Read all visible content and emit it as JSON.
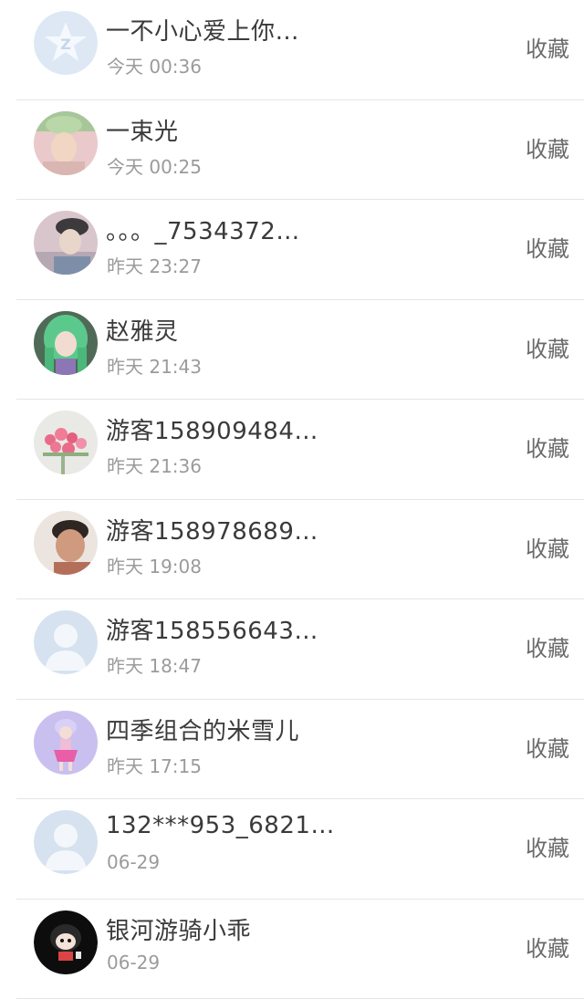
{
  "contacts": [
    {
      "name": "一不小心爱上你…",
      "time": "今天 00:36",
      "action": "收藏",
      "avatar": "qzone-star-avatar"
    },
    {
      "name": "一束光",
      "time": "今天 00:25",
      "action": "收藏",
      "avatar": "photo-avatar"
    },
    {
      "name": "。。。_7534372…",
      "time": "昨天 23:27",
      "action": "收藏",
      "avatar": "photo-avatar"
    },
    {
      "name": "赵雅灵",
      "time": "昨天 21:43",
      "action": "收藏",
      "avatar": "anime-avatar"
    },
    {
      "name": "游客158909484…",
      "time": "昨天 21:36",
      "action": "收藏",
      "avatar": "flowers-avatar"
    },
    {
      "name": "游客158978689…",
      "time": "昨天 19:08",
      "action": "收藏",
      "avatar": "photo-avatar"
    },
    {
      "name": "游客158556643…",
      "time": "昨天 18:47",
      "action": "收藏",
      "avatar": "default-person-avatar"
    },
    {
      "name": "四季组合的米雪儿",
      "time": "昨天 17:15",
      "action": "收藏",
      "avatar": "anime-avatar"
    },
    {
      "name": "132***953_6821…",
      "time": "06-29",
      "action": "收藏",
      "avatar": "default-person-avatar"
    },
    {
      "name": "银河游骑小乖",
      "time": "06-29",
      "action": "收藏",
      "avatar": "cartoon-avatar"
    }
  ],
  "colors": {
    "name": "#3a3a3a",
    "time": "#9b9b9b",
    "action": "#6a6a6a",
    "divider": "#e5e5e5"
  }
}
